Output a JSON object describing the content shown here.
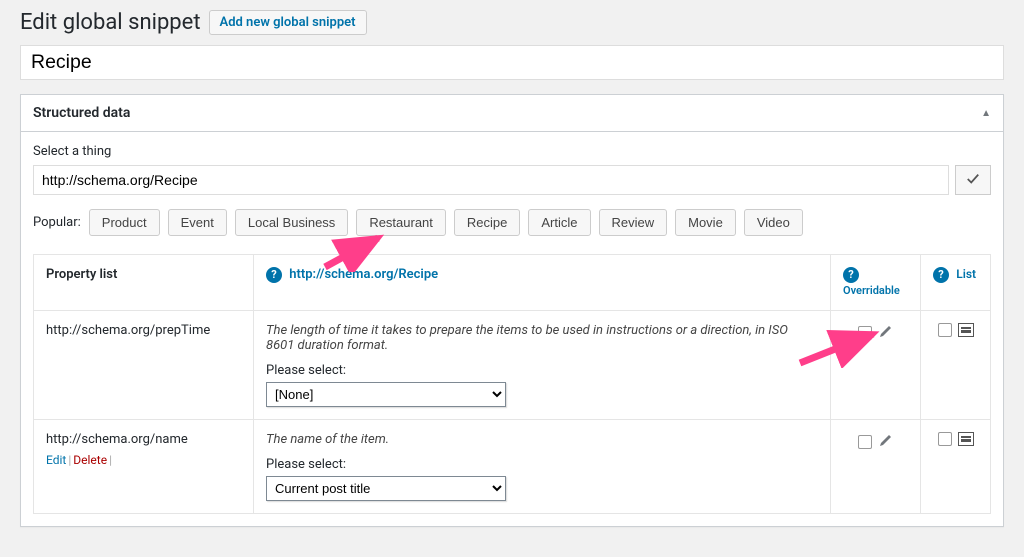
{
  "header": {
    "title": "Edit global snippet",
    "add_new": "Add new global snippet"
  },
  "title_value": "Recipe",
  "metabox": {
    "title": "Structured data"
  },
  "thing": {
    "label": "Select a thing",
    "value": "http://schema.org/Recipe"
  },
  "popular": {
    "label": "Popular:",
    "items": [
      "Product",
      "Event",
      "Local Business",
      "Restaurant",
      "Recipe",
      "Article",
      "Review",
      "Movie",
      "Video"
    ]
  },
  "table": {
    "headers": {
      "property": "Property list",
      "schema_link": "http://schema.org/Recipe",
      "overridable": "Overridable",
      "list": "List"
    },
    "select_label": "Please select:"
  },
  "rows": [
    {
      "name": "http://schema.org/prepTime",
      "desc": "The length of time it takes to prepare the items to be used in instructions or a direction, in ISO 8601 duration format.",
      "select_value": "[None]",
      "show_actions": false
    },
    {
      "name": "http://schema.org/name",
      "desc": "The name of the item.",
      "select_value": "Current post title",
      "show_actions": true
    }
  ],
  "actions": {
    "edit": "Edit",
    "delete": "Delete"
  }
}
